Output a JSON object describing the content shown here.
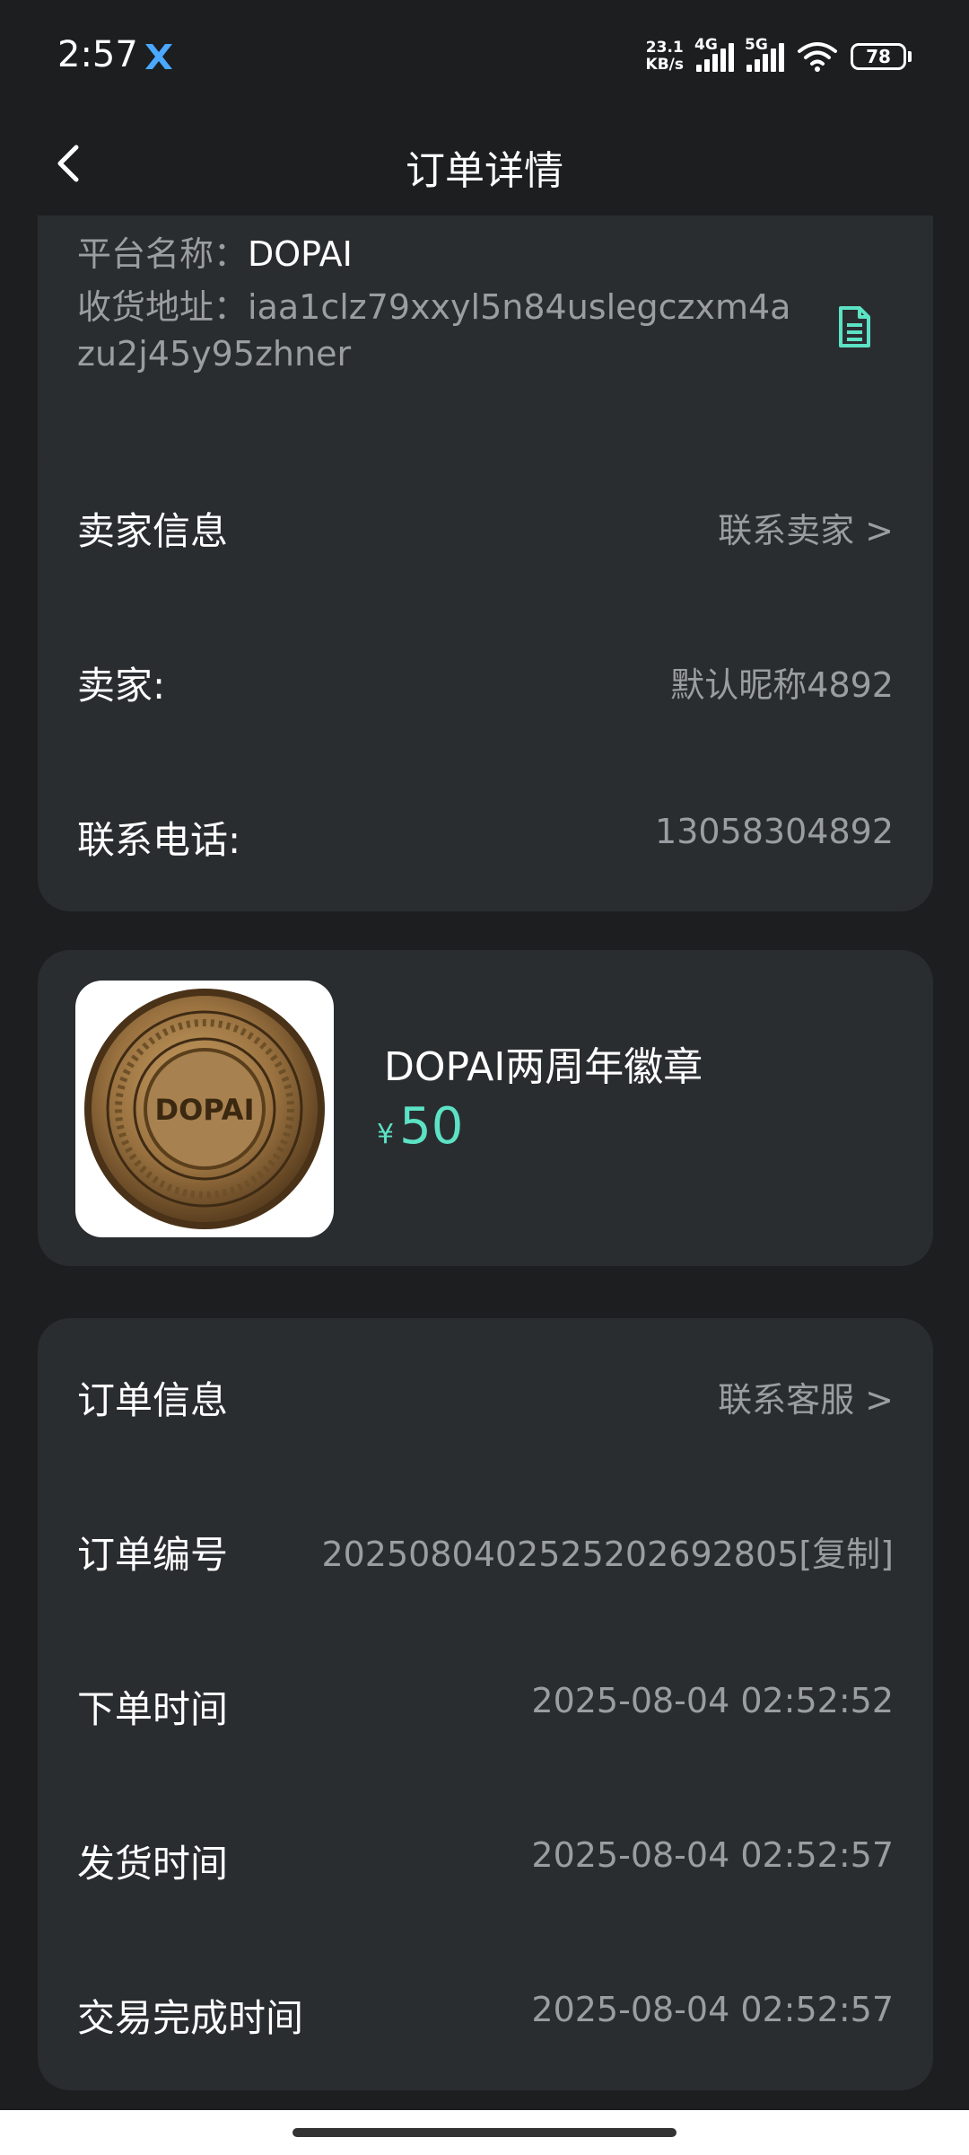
{
  "status_bar": {
    "time": "2:57",
    "net_speed_value": "23.1",
    "net_speed_unit": "KB/s",
    "signal_1_label": "4G",
    "signal_2_label": "5G",
    "battery": "78"
  },
  "header": {
    "title": "订单详情"
  },
  "address_card": {
    "platform_label": "平台名称：",
    "platform_value": "DOPAI",
    "address_label": "收货地址：",
    "address_value": "iaa1clz79xxyl5n84uslegczxm4azu2j45y95zhner"
  },
  "seller_card": {
    "title": "卖家信息",
    "action": "联系卖家 >",
    "seller_label": "卖家:",
    "seller_value": "默认昵称4892",
    "phone_label": "联系电话:",
    "phone_value": "13058304892"
  },
  "product_card": {
    "image_text": "DOPAI",
    "name": "DOPAI两周年徽章",
    "currency": "¥",
    "price": "50"
  },
  "order_card": {
    "title": "订单信息",
    "action": "联系客服 >",
    "rows": [
      {
        "label": "订单编号",
        "value": "2025080402525202692805[复制]"
      },
      {
        "label": "下单时间",
        "value": "2025-08-04 02:52:52"
      },
      {
        "label": "发货时间",
        "value": "2025-08-04 02:52:57"
      },
      {
        "label": "交易完成时间",
        "value": "2025-08-04 02:52:57"
      }
    ]
  },
  "colors": {
    "background": "#1c1e20",
    "card": "#2a2d30",
    "accent": "#5ce2c4",
    "muted_text": "#9a9da1"
  }
}
